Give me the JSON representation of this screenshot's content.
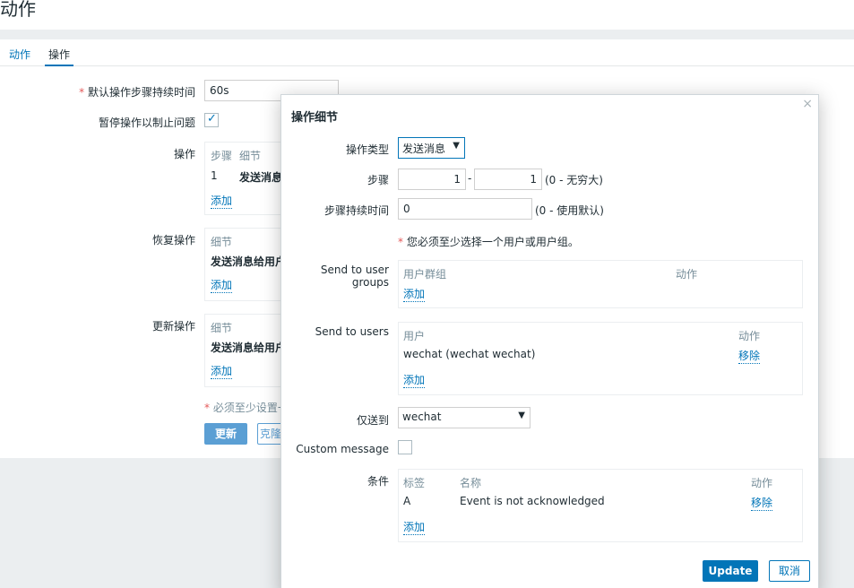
{
  "header": {
    "title": "动作"
  },
  "tabs": [
    "动作",
    "操作"
  ],
  "form": {
    "default_duration_label": "默认操作步骤持续时间",
    "default_duration_value": "60s",
    "pause_label": "暂停操作以制止问题",
    "operations_label": "操作",
    "operations_header_step": "步骤",
    "operations_header_detail": "细节",
    "operations_row_step": "1",
    "operations_row_detail": "发送消息",
    "operations_add": "添加",
    "recovery_label": "恢复操作",
    "recovery_header_detail": "细节",
    "recovery_row_detail": "发送消息给用户",
    "recovery_add": "添加",
    "update_label": "更新操作",
    "update_header_detail": "细节",
    "update_row_detail": "发送消息给用户",
    "update_add": "添加",
    "must_note": "必须至少设置一",
    "btn_update": "更新",
    "btn_clone": "克隆"
  },
  "modal": {
    "title": "操作细节",
    "close": "×",
    "op_type_label": "操作类型",
    "op_type_value": "发送消息",
    "steps_label": "步骤",
    "step_from": "1",
    "step_dash": "-",
    "step_to": "1",
    "step_note": "(0 - 无穷大)",
    "duration_label": "步骤持续时间",
    "duration_value": "0",
    "duration_note": "(0 - 使用默认)",
    "must_select_note": "您必须至少选择一个用户或用户组。",
    "user_groups_label": "Send to user groups",
    "ug_header_group": "用户群组",
    "ug_header_action": "动作",
    "ug_add": "添加",
    "users_label": "Send to users",
    "u_header_user": "用户",
    "u_header_action": "动作",
    "u_row_user": "wechat (wechat wechat)",
    "u_row_remove": "移除",
    "u_add": "添加",
    "only_send_label": "仅送到",
    "only_send_value": "wechat",
    "custom_message_label": "Custom message",
    "conditions_label": "条件",
    "c_header_label": "标签",
    "c_header_name": "名称",
    "c_header_action": "动作",
    "c_row_label": "A",
    "c_row_name": "Event is not acknowledged",
    "c_row_remove": "移除",
    "c_add": "添加",
    "btn_update": "Update",
    "btn_cancel": "取消"
  },
  "colors": {
    "accent": "#0275b8",
    "required": "#e45959",
    "muted": "#768d99"
  }
}
